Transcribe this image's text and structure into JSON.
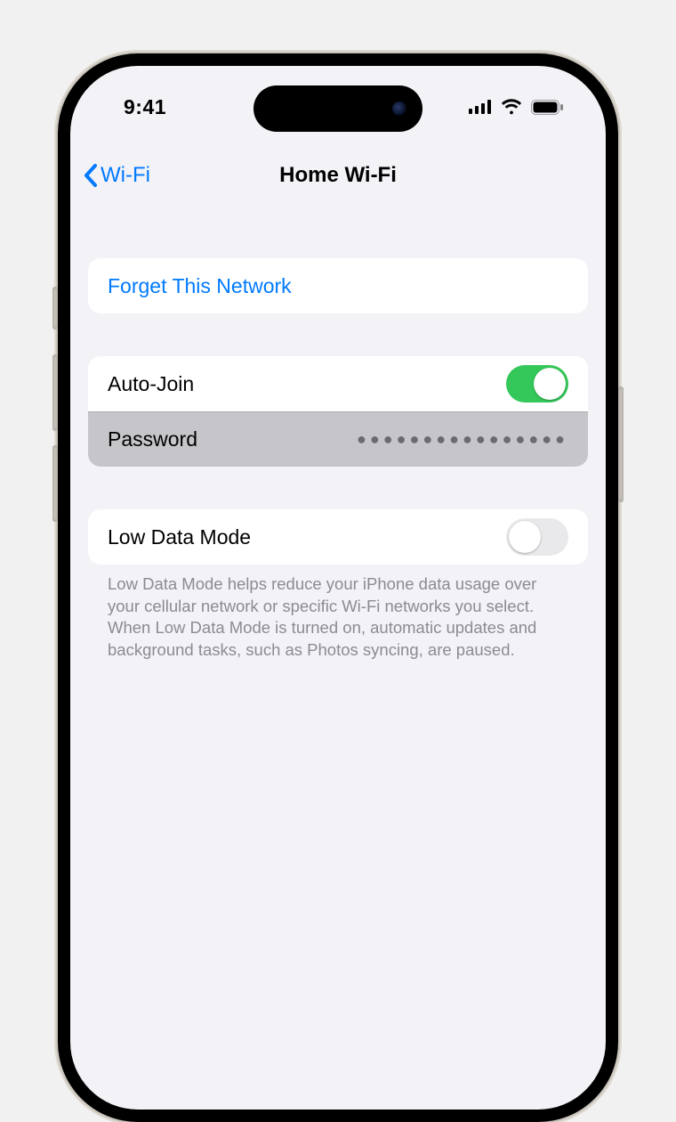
{
  "status": {
    "time": "9:41"
  },
  "nav": {
    "back_label": "Wi-Fi",
    "title": "Home Wi-Fi"
  },
  "group1": {
    "forget_label": "Forget This Network"
  },
  "group2": {
    "autojoin_label": "Auto-Join",
    "autojoin_on": true,
    "password_label": "Password",
    "password_mask": "●●●●●●●●●●●●●●●●"
  },
  "group3": {
    "lowdata_label": "Low Data Mode",
    "lowdata_on": false,
    "footer": "Low Data Mode helps reduce your iPhone data usage over your cellular network or specific Wi-Fi networks you select. When Low Data Mode is turned on, automatic updates and background tasks, such as Photos syncing, are paused."
  },
  "colors": {
    "accent": "#007aff",
    "toggle_on": "#34c759",
    "bg": "#f2f2f7"
  }
}
